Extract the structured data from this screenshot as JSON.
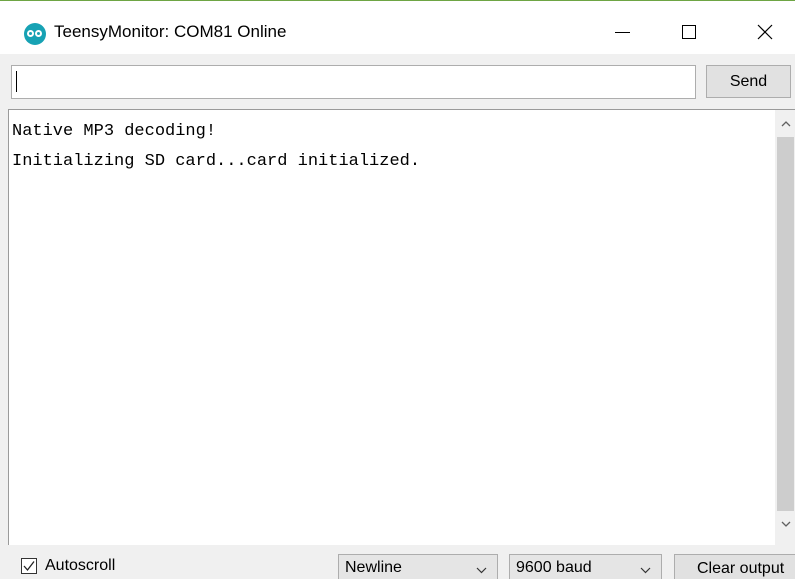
{
  "window": {
    "title": "TeensyMonitor: COM81 Online",
    "app_icon": "arduino-logo-icon",
    "controls": {
      "minimize_icon": "minimize-icon",
      "maximize_icon": "maximize-icon",
      "close_icon": "close-icon"
    },
    "accent_color": "#17a2b4"
  },
  "send_row": {
    "input_value": "",
    "send_label": "Send"
  },
  "output": {
    "lines": [
      "Native MP3 decoding!",
      "Initializing SD card...card initialized."
    ]
  },
  "footer": {
    "autoscroll_label": "Autoscroll",
    "autoscroll_checked": true,
    "line_ending": "Newline",
    "baud_rate": "9600 baud",
    "clear_label": "Clear output"
  }
}
